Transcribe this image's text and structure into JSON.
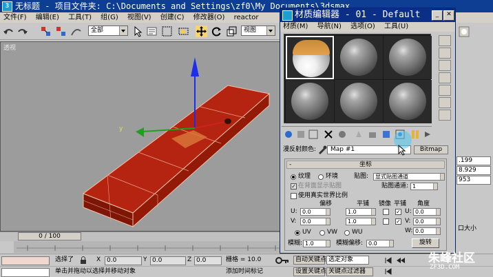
{
  "titlebar": {
    "title": "无标题   - 项目文件夹: C:\\Documents and Settings\\zf0\\My Documents\\3dsmax"
  },
  "menubar": {
    "items": [
      "文件(F)",
      "编辑(E)",
      "工具(T)",
      "组(G)",
      "视图(V)",
      "创建(C)",
      "修改器(O)",
      "reactor"
    ]
  },
  "toolbar": {
    "selection_filter": "全部",
    "ref_coord": "视图"
  },
  "viewport": {
    "label": "透视"
  },
  "timeline": {
    "slider_text": "0 / 100"
  },
  "statusbar": {
    "selected_label": "选择了",
    "x_label": "X",
    "x_value": "0.0",
    "y_label": "Y",
    "y_value": "0.0",
    "z_label": "Z",
    "z_value": "0.0",
    "grid_label": "栅格 = 10.0",
    "prompt": "单击并拖动以选择并移动对象",
    "add_time_tag": "添加时间标记",
    "auto_key": "自动关键点",
    "set_key": "设置关键点",
    "selected_object": "选定对象",
    "key_filter": "关键点过滤器"
  },
  "cmdpanel": {
    "fields": [
      ".199",
      "8.929",
      "953"
    ],
    "bottom_label": "口大小"
  },
  "material_editor": {
    "title": "材质编辑器 - 01 - Default",
    "menu": [
      "材质(M)",
      "导航(N)",
      "选项(O)",
      "工具(U)"
    ],
    "diffuse_label": "漫反射颜色:",
    "map_name": "Map #1",
    "map_type": "Bitmap",
    "coordinates": {
      "header": "坐标",
      "texture": "纹理",
      "environ": "环境",
      "mapping_label": "贴图:",
      "mapping_value": "显式贴图通道",
      "show_on_back": "在背面显示贴图",
      "map_channel_label": "贴图通道:",
      "map_channel_value": "1",
      "real_world": "使用真实世界比例",
      "col_offset": "偏移",
      "col_tiling": "平铺",
      "col_mirror": "镜像",
      "col_tile": "平铺",
      "col_angle": "角度",
      "u_label": "U:",
      "v_label": "V:",
      "w_label": "W:",
      "u_offset": "0.0",
      "v_offset": "0.0",
      "u_tiling": "1.0",
      "v_tiling": "1.0",
      "u_angle": "0.0",
      "v_angle": "0.0",
      "w_angle": "0.0",
      "uv": "UV",
      "vw": "VW",
      "wu": "WU",
      "blur_label": "模糊:",
      "blur_value": "1.0",
      "blur_offset_label": "模糊偏移:",
      "blur_offset_value": "0.0",
      "rotate_button": "旋转"
    }
  },
  "watermark": {
    "text": "朱峰社区",
    "url": "ZF3D.COM"
  },
  "colors": {
    "title_blue": "#0b2f86",
    "object_red": "#a31b0a",
    "viewport_gray": "#9c9c9c"
  }
}
